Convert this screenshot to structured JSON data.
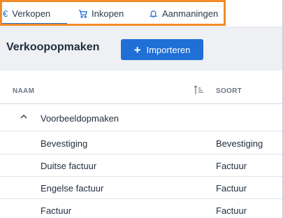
{
  "tabs": [
    {
      "label": "Verkopen",
      "icon": "euro-icon",
      "active": true
    },
    {
      "label": "Inkopen",
      "icon": "cart-icon",
      "active": false
    },
    {
      "label": "Aanmaningen",
      "icon": "bell-icon",
      "active": false
    }
  ],
  "header": {
    "title": "Verkoopopmaken",
    "import_label": "Importeren"
  },
  "table": {
    "columns": {
      "name": "NAAM",
      "kind": "SOORT"
    },
    "group": {
      "label": "Voorbeeldopmaken"
    },
    "rows": [
      {
        "name": "Bevestiging",
        "kind": "Bevestiging"
      },
      {
        "name": "Duitse factuur",
        "kind": "Factuur"
      },
      {
        "name": "Engelse factuur",
        "kind": "Factuur"
      },
      {
        "name": "Factuur",
        "kind": "Factuur"
      }
    ]
  },
  "colors": {
    "accent": "#1f6fd6",
    "highlight": "#f28c28",
    "header_bg": "#eef0f3"
  }
}
